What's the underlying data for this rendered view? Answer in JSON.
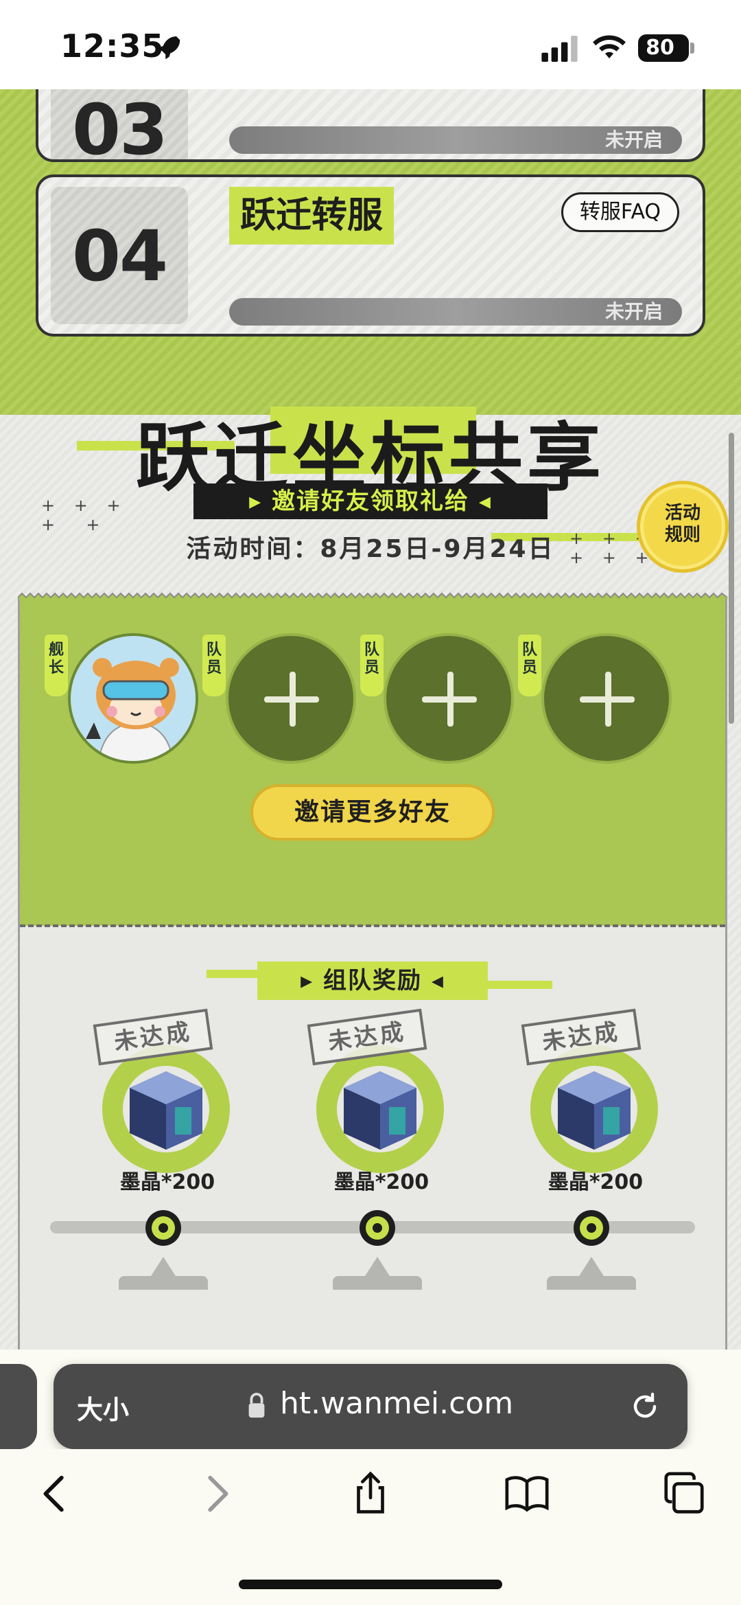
{
  "status_bar": {
    "time": "12:35",
    "battery": "80"
  },
  "stages": [
    {
      "number": "03",
      "status": "未开启"
    },
    {
      "number": "04",
      "title": "跃迁转服",
      "faq_label": "转服FAQ",
      "status": "未开启"
    }
  ],
  "event": {
    "title": "跃迁坐标共享",
    "subtitle": "▸ 邀请好友领取礼给 ◂",
    "time": "活动时间：8月25日-9月24日",
    "rules_line1": "活动",
    "rules_line2": "规则"
  },
  "team": {
    "captain_tag": "舰长",
    "member_tag": "队员",
    "invite_button": "邀请更多好友"
  },
  "rewards": {
    "header": "▸ 组队奖励 ◂",
    "items": [
      {
        "stamp": "未达成",
        "label": "墨晶*200"
      },
      {
        "stamp": "未达成",
        "label": "墨晶*200"
      },
      {
        "stamp": "未达成",
        "label": "墨晶*200"
      }
    ]
  },
  "browser": {
    "text_size_label": "大小",
    "url": "ht.wanmei.com"
  },
  "icons": {
    "status": [
      "rocket-icon",
      "cellular-signal-icon",
      "wifi-icon",
      "battery-icon"
    ],
    "browser": [
      "lock-icon",
      "reload-icon",
      "back-icon",
      "forward-icon",
      "share-icon",
      "bookmarks-icon",
      "tabs-icon"
    ]
  }
}
